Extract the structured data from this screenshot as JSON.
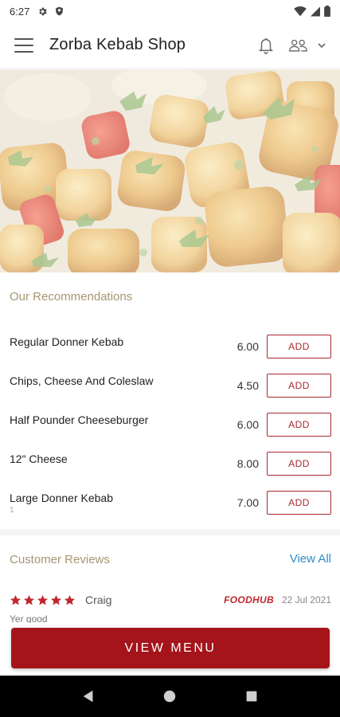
{
  "status_bar": {
    "time": "6:27",
    "left_icons": [
      "gear-icon",
      "shield-icon"
    ],
    "right_icons": [
      "wifi-icon",
      "signal-icon",
      "battery-icon"
    ]
  },
  "app_bar": {
    "title": "Zorba Kebab Shop",
    "icons": [
      "menu-icon",
      "bell-icon",
      "group-icon",
      "chevron-down-icon"
    ]
  },
  "hero": {
    "image": "food-photo"
  },
  "recommendations": {
    "title": "Our Recommendations",
    "add_label": "ADD",
    "items": [
      {
        "name": "Regular Donner Kebab",
        "price": "6.00",
        "sub": ""
      },
      {
        "name": "Chips, Cheese And Coleslaw",
        "price": "4.50",
        "sub": ""
      },
      {
        "name": "Half Pounder Cheeseburger",
        "price": "6.00",
        "sub": ""
      },
      {
        "name": "12\" Cheese",
        "price": "8.00",
        "sub": ""
      },
      {
        "name": "Large Donner Kebab",
        "price": "7.00",
        "sub": "1"
      }
    ]
  },
  "reviews": {
    "title": "Customer Reviews",
    "view_all": "View All",
    "items": [
      {
        "rating": 5,
        "reviewer": "Craig",
        "source": "FOODHUB",
        "date": "22 Jul 2021",
        "text": "Yer good"
      }
    ]
  },
  "cta": {
    "label": "VIEW MENU"
  },
  "colors": {
    "accent": "#a5141b",
    "section_title": "#a89572",
    "link": "#2d8fc4",
    "star": "#c0272d"
  }
}
